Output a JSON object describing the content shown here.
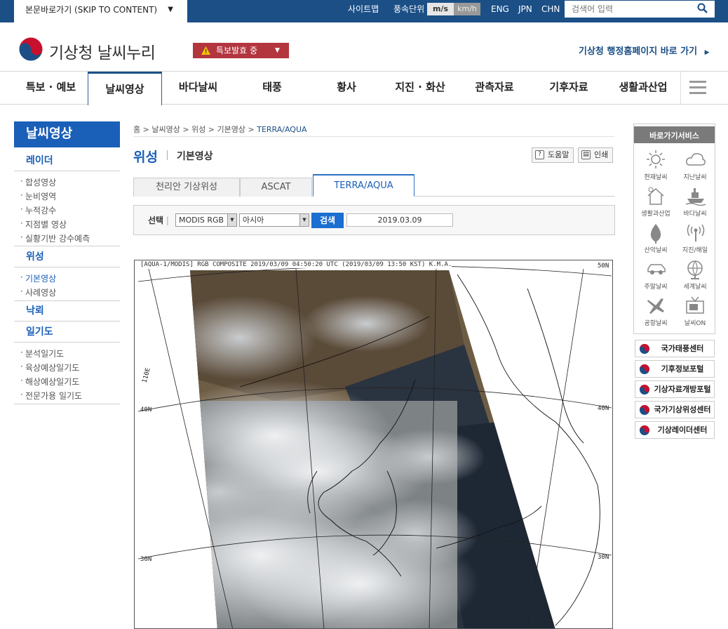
{
  "topbar": {
    "skip_label": "본문바로가기 (SKIP TO CONTENT)",
    "sitemap": "사이트맵",
    "wind_unit_label": "풍속단위",
    "unit_ms": "m/s",
    "unit_kmh": "km/h",
    "lang_eng": "ENG",
    "lang_jpn": "JPN",
    "lang_chn": "CHN",
    "search_placeholder": "검색어 입력"
  },
  "header": {
    "logo_text": "기상청 날씨누리",
    "alert_label": "특보발효 중",
    "admin_link": "기상청 행정홈페이지 바로 가기"
  },
  "gnb": {
    "items": [
      "특보 · 예보",
      "날씨영상",
      "바다날씨",
      "태풍",
      "황사",
      "지진 · 화산",
      "관측자료",
      "기후자료",
      "생활과산업"
    ]
  },
  "lnb": {
    "title": "날씨영상",
    "radar": "레이더",
    "radar_items": [
      "합성영상",
      "눈비영역",
      "누적강수",
      "지점별 영상",
      "실황기반 강수예측"
    ],
    "satellite": "위성",
    "satellite_items": [
      "기본영상",
      "사례영상"
    ],
    "lightning": "낙뢰",
    "weather_map": "일기도",
    "weather_map_items": [
      "분석일기도",
      "육상예상일기도",
      "해상예상일기도",
      "전문가용 일기도"
    ]
  },
  "breadcrumb": {
    "items": [
      "홈",
      "날씨영상",
      "위성",
      "기본영상"
    ],
    "current": "TERRA/AQUA"
  },
  "page": {
    "title": "위성",
    "subtitle": "기본영상",
    "help_label": "도움말",
    "print_label": "인쇄"
  },
  "tabs": [
    "천리안 기상위성",
    "ASCAT",
    "TERRA/AQUA"
  ],
  "form": {
    "label": "선택",
    "select1": "MODIS RGB",
    "select2": "아시아",
    "search_button": "검색",
    "date": "2019.03.09"
  },
  "satellite_image": {
    "caption": "[AQUA-1/MODIS] RGB COMPOSITE 2019/03/09 04:50:20 UTC (2019/03/09 13:50 KST) K.M.A.",
    "lat_labels": [
      "40N",
      "40N",
      "30N",
      "30N",
      "50N"
    ],
    "lon_label": "110E"
  },
  "sidebar": {
    "title": "바로가기서비스",
    "services": [
      "현재날씨",
      "지난날씨",
      "생활과산업",
      "바다날씨",
      "산악날씨",
      "지진/해일",
      "주말날씨",
      "세계날씨",
      "공항날씨",
      "날씨ON"
    ],
    "banners": [
      "국가태풍센터",
      "기후정보포털",
      "기상자료개방포털",
      "국가기상위성센터",
      "기상레이더센터"
    ]
  },
  "colors": {
    "topbar": "#1b4f86",
    "accent": "#1a5fb8",
    "alert": "#b3353e"
  }
}
